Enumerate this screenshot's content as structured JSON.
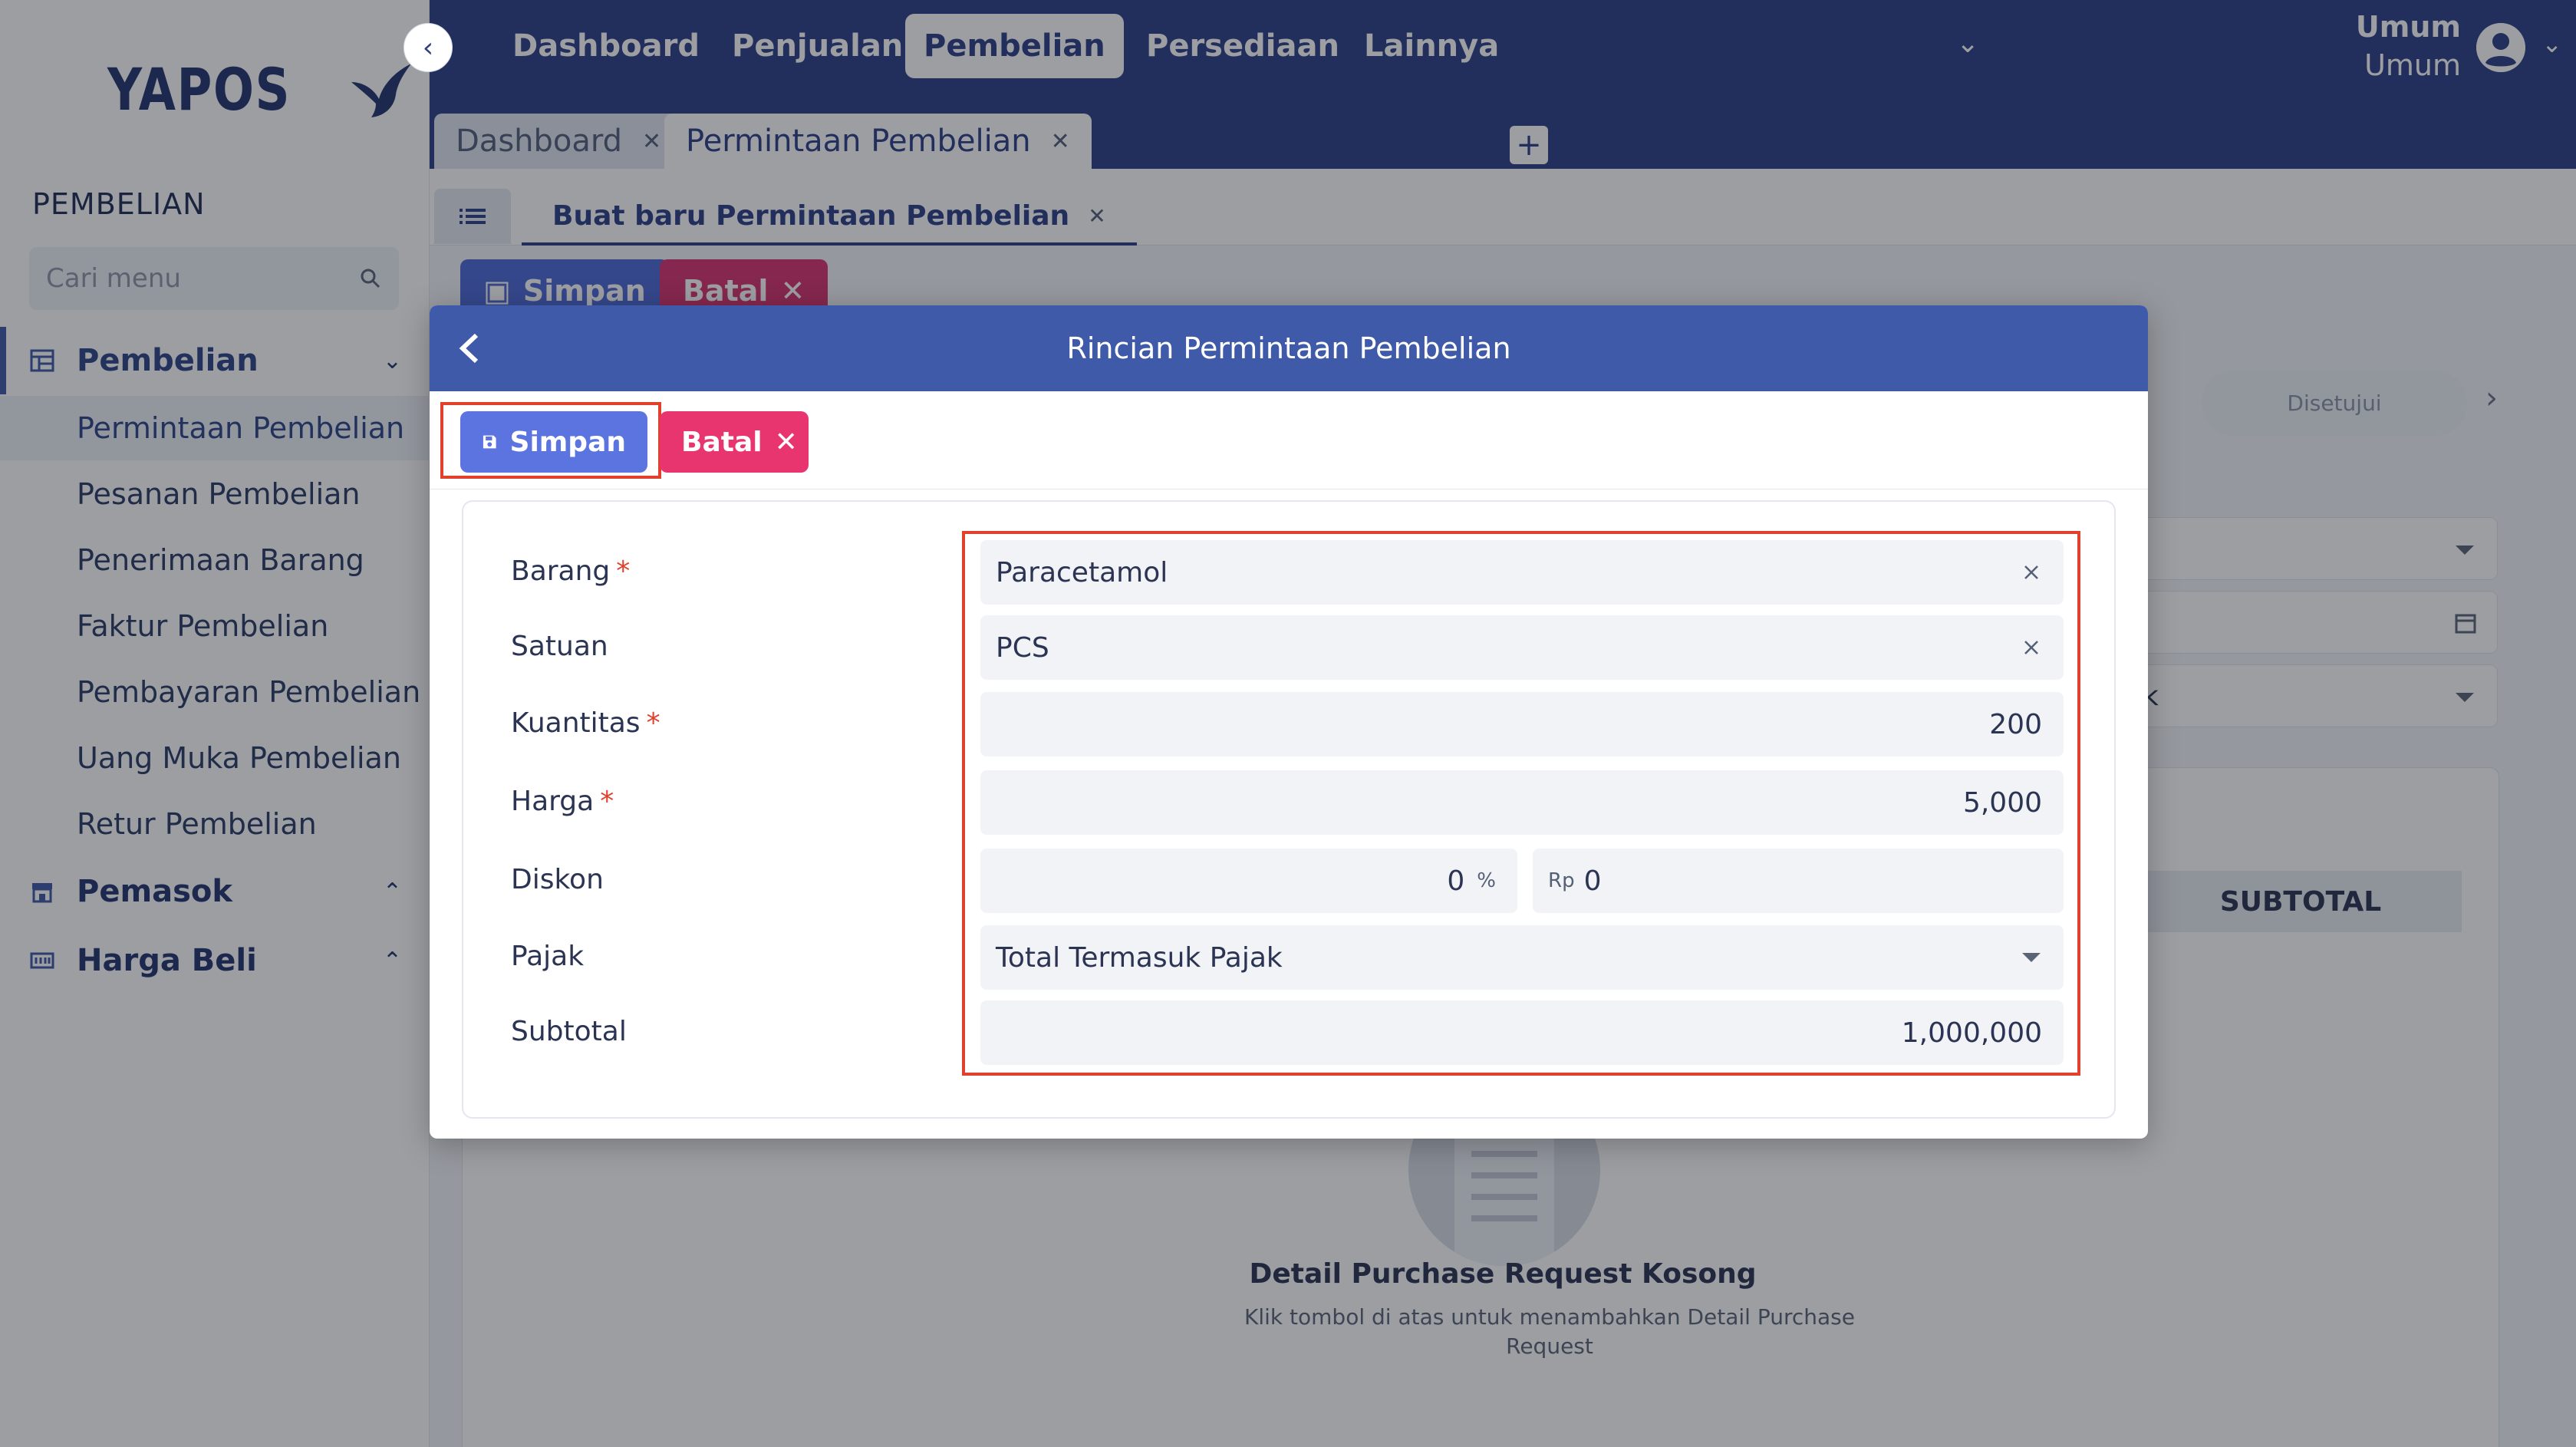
{
  "sidebar": {
    "logo": "YAPOS",
    "section_title": "PEMBELIAN",
    "search_placeholder": "Cari menu",
    "groups": [
      {
        "label": "Pembelian"
      },
      {
        "label": "Pemasok"
      },
      {
        "label": "Harga Beli"
      }
    ],
    "items": [
      {
        "label": "Permintaan Pembelian"
      },
      {
        "label": "Pesanan Pembelian"
      },
      {
        "label": "Penerimaan Barang"
      },
      {
        "label": "Faktur Pembelian"
      },
      {
        "label": "Pembayaran Pembelian"
      },
      {
        "label": "Uang Muka Pembelian"
      },
      {
        "label": "Retur Pembelian"
      }
    ]
  },
  "topbar": {
    "menus": [
      {
        "label": "Dashboard"
      },
      {
        "label": "Penjualan"
      },
      {
        "label": "Pembelian"
      },
      {
        "label": "Persediaan"
      },
      {
        "label": "Lainnya"
      }
    ],
    "user_line1": "Umum",
    "user_line2": "Umum"
  },
  "window_tabs": [
    {
      "label": "Dashboard"
    },
    {
      "label": "Permintaan Pembelian"
    }
  ],
  "page": {
    "subtab_label": "Buat baru Permintaan Pembelian",
    "save_label": "Simpan",
    "cancel_label": "Batal",
    "status_label": "Disetujui",
    "tax_partial": "ak",
    "subtotal_header": "SUBTOTAL",
    "empty_title": "Detail Purchase Request Kosong",
    "empty_desc": "Klik tombol di atas untuk menambahkan Detail Purchase Request"
  },
  "modal": {
    "title": "Rincian Permintaan Pembelian",
    "save_label": "Simpan",
    "cancel_label": "Batal",
    "fields": {
      "barang": {
        "label": "Barang",
        "value": "Paracetamol"
      },
      "satuan": {
        "label": "Satuan",
        "value": "PCS"
      },
      "kuantitas": {
        "label": "Kuantitas",
        "value": "200"
      },
      "harga": {
        "label": "Harga",
        "value": "5,000"
      },
      "diskon": {
        "label": "Diskon",
        "percent_value": "0",
        "percent_unit": "%",
        "rp_prefix": "Rp",
        "rp_value": "0"
      },
      "pajak": {
        "label": "Pajak",
        "value": "Total Termasuk Pajak"
      },
      "subtotal": {
        "label": "Subtotal",
        "value": "1,000,000"
      }
    },
    "required_mark": "*"
  },
  "colors": {
    "brand_dark": "#2d3f87",
    "header_blue": "#3f5aa8",
    "save_blue": "#5b74e0",
    "cancel_pink": "#e8346f",
    "highlight_red": "#e0402c"
  }
}
